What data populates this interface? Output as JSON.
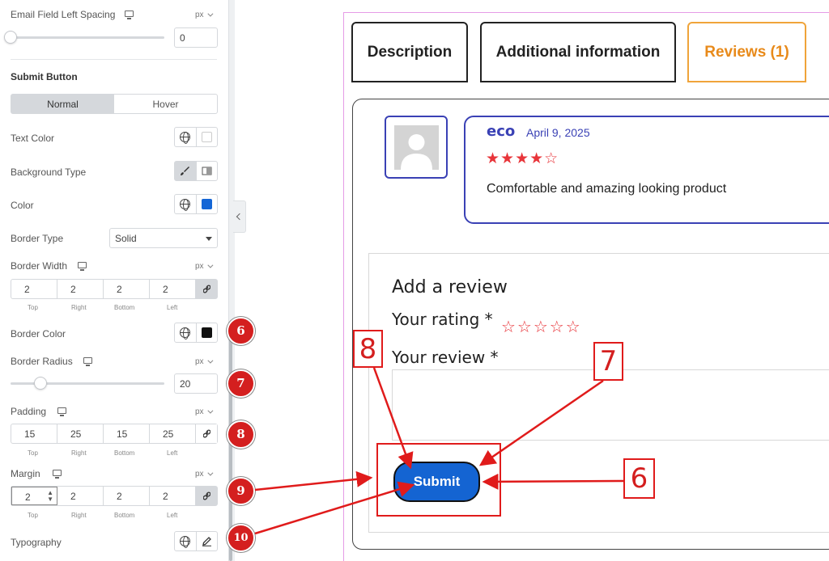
{
  "panel": {
    "email_spacing": {
      "label": "Email Field Left Spacing",
      "unit": "px",
      "value": "0"
    },
    "section_title": "Submit Button",
    "tabs": [
      {
        "label": "Normal"
      },
      {
        "label": "Hover"
      }
    ],
    "text_color": {
      "label": "Text Color",
      "swatch": "#ffffff"
    },
    "background_type": {
      "label": "Background Type"
    },
    "color": {
      "label": "Color",
      "swatch": "#1466d6"
    },
    "border_type": {
      "label": "Border Type",
      "value": "Solid"
    },
    "border_width": {
      "label": "Border Width",
      "unit": "px",
      "values": [
        "2",
        "2",
        "2",
        "2"
      ]
    },
    "border_color": {
      "label": "Border Color",
      "swatch": "#111111"
    },
    "border_radius": {
      "label": "Border Radius",
      "unit": "px",
      "value": "20"
    },
    "padding": {
      "label": "Padding",
      "unit": "px",
      "values": [
        "15",
        "25",
        "15",
        "25"
      ]
    },
    "margin": {
      "label": "Margin",
      "unit": "px",
      "values": [
        "2",
        "2",
        "2",
        "2"
      ]
    },
    "side_labels": [
      "Top",
      "Right",
      "Bottom",
      "Left"
    ],
    "typography": {
      "label": "Typography"
    },
    "markers": [
      "6",
      "7",
      "8",
      "9",
      "10"
    ]
  },
  "preview": {
    "tabs": [
      {
        "label": "Description"
      },
      {
        "label": "Additional information"
      },
      {
        "label": "Reviews (1)"
      }
    ],
    "review": {
      "author": "eco",
      "date": "April 9, 2025",
      "stars": "★★★★☆",
      "text": "Comfortable and amazing looking product"
    },
    "form": {
      "title": "Add a review",
      "rating_label": "Your rating *",
      "rating_stars": "☆☆☆☆☆",
      "review_label": "Your review *",
      "submit_label": "Submit"
    },
    "annotations": [
      "8",
      "7",
      "6"
    ]
  },
  "colors": {
    "accent_orange": "#e88a1a",
    "review_blue": "#3a41b5",
    "button_blue": "#1464d2",
    "annotation_red": "#e01b1b"
  }
}
